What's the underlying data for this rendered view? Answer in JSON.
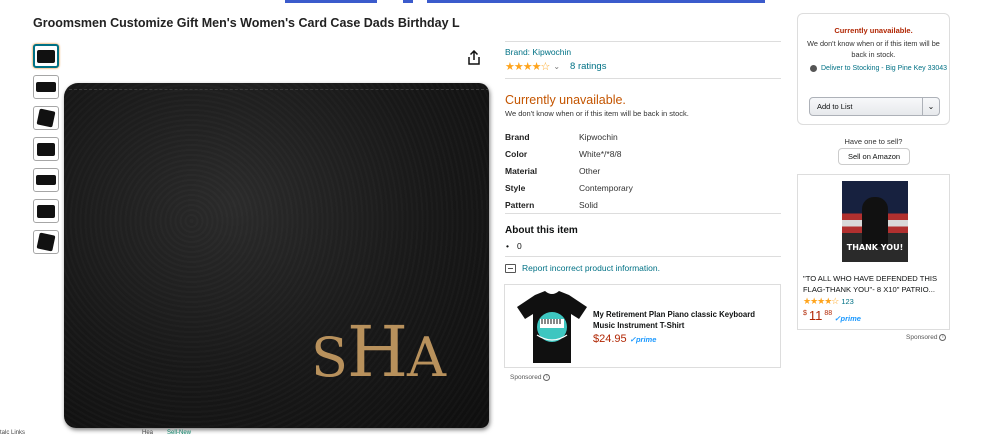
{
  "product": {
    "title": "Groomsmen Customize Gift Men's Women's Card Case Dads Birthday L",
    "brand_link": "Brand: Kipwochin",
    "stars": "★★★★☆",
    "ratings_count": "8 ratings",
    "monogram": {
      "left": "S",
      "middle": "H",
      "right": "A"
    },
    "availability": "Currently unavailable.",
    "availability_note": "We don't know when or if this item will be back in stock.",
    "specs": [
      {
        "key": "Brand",
        "value": "Kipwochin"
      },
      {
        "key": "Color",
        "value": "White*/*8/8"
      },
      {
        "key": "Material",
        "value": "Other"
      },
      {
        "key": "Style",
        "value": "Contemporary"
      },
      {
        "key": "Pattern",
        "value": "Solid"
      }
    ],
    "about_title": "About this item",
    "about_items": [
      "0"
    ],
    "report_link": "Report incorrect product information."
  },
  "sponsored_ad": {
    "title": "My Retirement Plan Piano classic Keyboard Music Instrument T-Shirt",
    "price": "$24.95",
    "prime": "✓prime",
    "sponsored_label": "Sponsored"
  },
  "buybox": {
    "unavailable": "Currently unavailable.",
    "note": "We don't know when or if this item will be back in stock.",
    "deliver": "Deliver to Stocking - Big Pine Key 33043",
    "add_to_list": "Add to List"
  },
  "sell": {
    "question": "Have one to sell?",
    "button": "Sell on Amazon"
  },
  "side_ad": {
    "poster_text": "THANK YOU!",
    "title": "\"TO ALL WHO HAVE DEFENDED THIS FLAG-THANK YOU\"- 8 X10\" PATRIO...",
    "stars": "★★★★☆",
    "rating_count": "123",
    "price_symbol": "$",
    "price_whole": "11",
    "price_fraction": "88",
    "prime": "✓prime",
    "sponsored_label": "Sponsored"
  },
  "bottom_strip": {
    "left": "talc   Links",
    "middle": "Hea",
    "right": "Sell-New"
  },
  "colors": {
    "link": "#007185",
    "unavailable": "#c45500",
    "price": "#b12704",
    "star": "#ffa41c"
  }
}
